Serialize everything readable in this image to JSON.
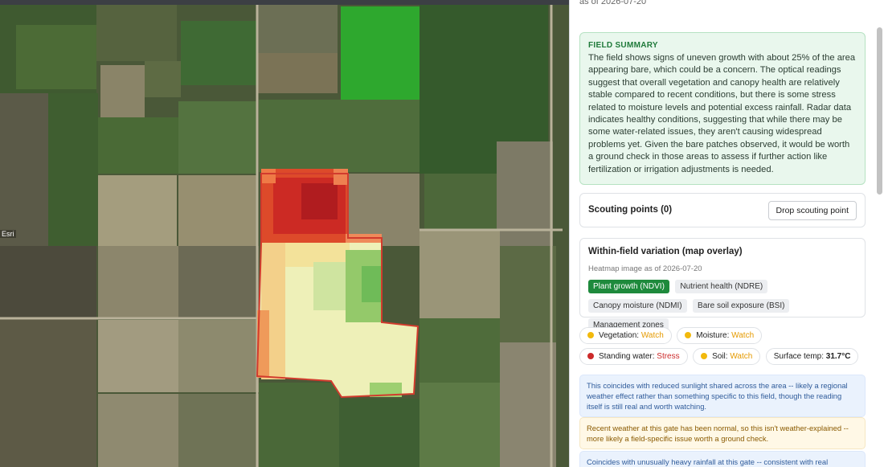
{
  "map": {
    "attribution": "Esri",
    "colors": {
      "red": "#c9201f",
      "orange": "#ee7a3a",
      "yellow": "#f6eaa0",
      "green": "#8cc964",
      "outline": "#d23b2d",
      "brightfield": "#2ea82e"
    }
  },
  "panel": {
    "as_of_top": "as of 2026-07-20",
    "summary": {
      "title": "FIELD SUMMARY",
      "text": "The field shows signs of uneven growth with about 25% of the area appearing bare, which could be a concern. The optical readings suggest that overall vegetation and canopy health are relatively stable compared to recent conditions, but there is some stress related to moisture levels and potential excess rainfall. Radar data indicates healthy conditions, suggesting that while there may be some water-related issues, they aren't causing widespread problems yet. Given the bare patches observed, it would be worth a ground check in those areas to assess if further action like fertilization or irrigation adjustments is needed."
    },
    "scouting": {
      "label": "Scouting points (0)",
      "button": "Drop scouting point"
    },
    "variation": {
      "title": "Within-field variation (map overlay)",
      "subtitle": "Heatmap image as of 2026-07-20",
      "layers": [
        {
          "label": "Plant growth (NDVI)",
          "active": true
        },
        {
          "label": "Nutrient health (NDRE)",
          "active": false
        },
        {
          "label": "Canopy moisture (NDMI)",
          "active": false
        },
        {
          "label": "Bare soil exposure (BSI)",
          "active": false
        },
        {
          "label": "Management zones",
          "active": false
        }
      ]
    },
    "status": {
      "vegetation": {
        "label": "Vegetation:",
        "value": "Watch",
        "color": "#f2b90c"
      },
      "moisture": {
        "label": "Moisture:",
        "value": "Watch",
        "color": "#f2b90c"
      },
      "standing_water": {
        "label": "Standing water:",
        "value": "Stress",
        "color": "#cc2a2a"
      },
      "soil": {
        "label": "Soil:",
        "value": "Watch",
        "color": "#f2b90c"
      },
      "surface_temp": {
        "label": "Surface temp:",
        "value": "31.7°C"
      }
    },
    "notes": [
      {
        "kind": "blue",
        "text": "This coincides with reduced sunlight shared across the area -- likely a regional weather effect rather than something specific to this field, though the reading itself is still real and worth watching."
      },
      {
        "kind": "yellow",
        "text": "Recent weather at this gate has been normal, so this isn't weather-explained -- more likely a field-specific issue worth a ground check."
      },
      {
        "kind": "blue",
        "text": "Coincides with unusually heavy rainfall at this gate -- consistent with real"
      }
    ]
  }
}
